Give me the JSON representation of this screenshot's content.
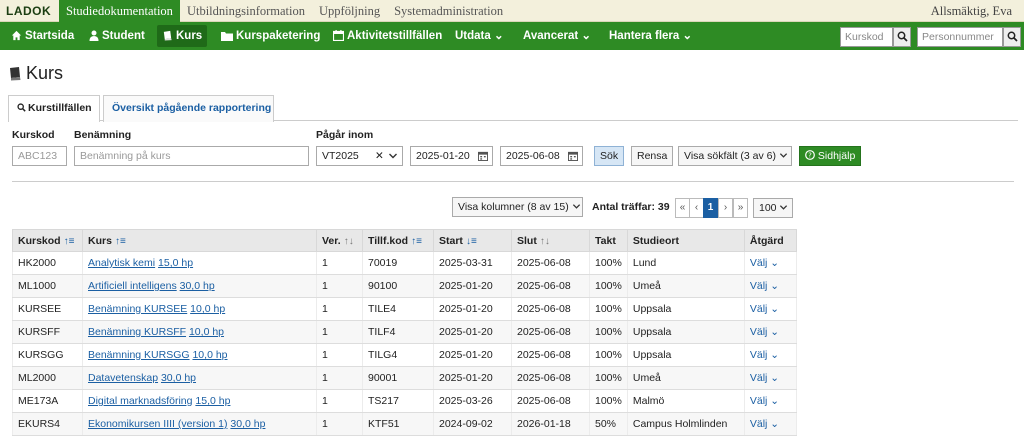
{
  "topbar": {
    "logo": "LADOK",
    "tabs": [
      "Studiedokumentation",
      "Utbildningsinformation",
      "Uppföljning",
      "Systemadministration"
    ],
    "user": "Allsmäktig, Eva"
  },
  "nav": {
    "items": [
      "Startsida",
      "Student",
      "Kurs",
      "Kurspaketering",
      "Aktivitetstillfällen",
      "Utdata",
      "Avancerat",
      "Hantera flera"
    ],
    "search1_placeholder": "Kurskod",
    "search2_placeholder": "Personnummer"
  },
  "page": {
    "title": "Kurs",
    "tabs": [
      "Kurstillfällen",
      "Översikt pågående rapportering"
    ]
  },
  "filters": {
    "kurskod_label": "Kurskod",
    "kurskod_placeholder": "ABC123",
    "benamning_label": "Benämning",
    "benamning_placeholder": "Benämning på kurs",
    "pagar_label": "Pågår inom",
    "term_value": "VT2025",
    "clear_symbol": "✕",
    "date_from": "2025-01-20",
    "date_to": "2025-06-08",
    "search_button": "Sök",
    "clear_button": "Rensa",
    "fields_select": "Visa sökfält (3 av 6)",
    "help_button": "Sidhjälp"
  },
  "results": {
    "columns_select": "Visa kolumner (8 av 15)",
    "total_label": "Antal träffar: 39",
    "pager": [
      "«",
      "‹",
      "1",
      "›",
      "»"
    ],
    "page_size": "100"
  },
  "table": {
    "headers": [
      "Kurskod",
      "Kurs",
      "Ver.",
      "Tillf.kod",
      "Start",
      "Slut",
      "Takt",
      "Studieort",
      "Åtgärd"
    ],
    "action_label": "Välj",
    "rows": [
      {
        "kurskod": "HK2000",
        "kurs": "Analytisk kemi",
        "hp": "15,0 hp",
        "ver": "1",
        "tillf": "70019",
        "start": "2025-03-31",
        "slut": "2025-06-08",
        "takt": "100%",
        "ort": "Lund"
      },
      {
        "kurskod": "ML1000",
        "kurs": "Artificiell intelligens",
        "hp": "30,0 hp",
        "ver": "1",
        "tillf": "90100",
        "start": "2025-01-20",
        "slut": "2025-06-08",
        "takt": "100%",
        "ort": "Umeå"
      },
      {
        "kurskod": "KURSEE",
        "kurs": "Benämning KURSEE",
        "hp": "10,0 hp",
        "ver": "1",
        "tillf": "TILE4",
        "start": "2025-01-20",
        "slut": "2025-06-08",
        "takt": "100%",
        "ort": "Uppsala"
      },
      {
        "kurskod": "KURSFF",
        "kurs": "Benämning KURSFF",
        "hp": "10,0 hp",
        "ver": "1",
        "tillf": "TILF4",
        "start": "2025-01-20",
        "slut": "2025-06-08",
        "takt": "100%",
        "ort": "Uppsala"
      },
      {
        "kurskod": "KURSGG",
        "kurs": "Benämning KURSGG",
        "hp": "10,0 hp",
        "ver": "1",
        "tillf": "TILG4",
        "start": "2025-01-20",
        "slut": "2025-06-08",
        "takt": "100%",
        "ort": "Uppsala"
      },
      {
        "kurskod": "ML2000",
        "kurs": "Datavetenskap",
        "hp": "30,0 hp",
        "ver": "1",
        "tillf": "90001",
        "start": "2025-01-20",
        "slut": "2025-06-08",
        "takt": "100%",
        "ort": "Umeå"
      },
      {
        "kurskod": "ME173A",
        "kurs": "Digital marknadsföring",
        "hp": "15,0 hp",
        "ver": "1",
        "tillf": "TS217",
        "start": "2025-03-26",
        "slut": "2025-06-08",
        "takt": "100%",
        "ort": "Malmö"
      },
      {
        "kurskod": "EKURS4",
        "kurs": "Ekonomikursen IIII (version 1)",
        "hp": "30,0 hp",
        "ver": "1",
        "tillf": "KTF51",
        "start": "2024-09-02",
        "slut": "2026-01-18",
        "takt": "50%",
        "ort": "Campus Holmlinden"
      }
    ]
  }
}
